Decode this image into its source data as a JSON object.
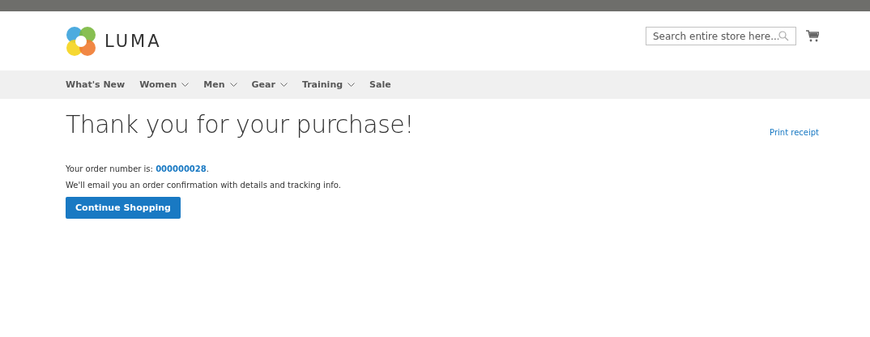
{
  "header": {
    "logo_text": "LUMA",
    "search": {
      "placeholder": "Search entire store here..."
    }
  },
  "nav": [
    {
      "label": "What's New",
      "has_submenu": false
    },
    {
      "label": "Women",
      "has_submenu": true
    },
    {
      "label": "Men",
      "has_submenu": true
    },
    {
      "label": "Gear",
      "has_submenu": true
    },
    {
      "label": "Training",
      "has_submenu": true
    },
    {
      "label": "Sale",
      "has_submenu": false
    }
  ],
  "page": {
    "title": "Thank you for your purchase!",
    "print_link": "Print receipt",
    "order_prefix": "Your order number is: ",
    "order_number": "000000028",
    "order_suffix": ".",
    "email_note": "We'll email you an order confirmation with details and tracking info.",
    "button": "Continue Shopping"
  }
}
